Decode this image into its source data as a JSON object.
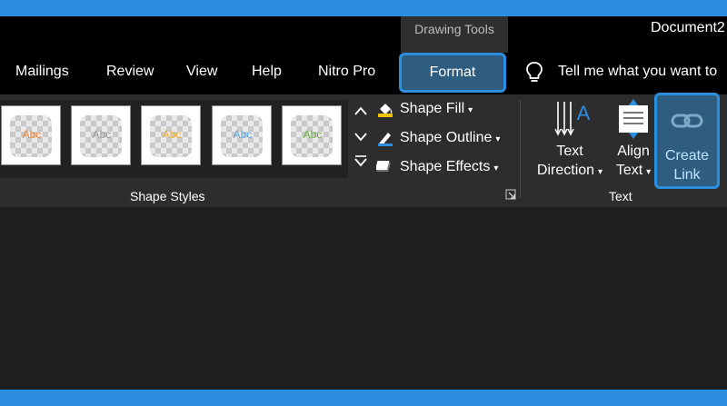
{
  "window": {
    "context_label": "Drawing Tools",
    "doc_title": "Document2"
  },
  "tabs": {
    "mailings": "Mailings",
    "review": "Review",
    "view": "View",
    "help": "Help",
    "nitro": "Nitro Pro",
    "format": "Format"
  },
  "tellme": "Tell me what you want to",
  "shape_styles": {
    "group_label": "Shape Styles",
    "thumb_text": "Abc",
    "thumb_colors": [
      "#f0863a",
      "#9b9b9b",
      "#f0b030",
      "#5ba8e0",
      "#6fb04a"
    ],
    "fill_label": "Shape Fill",
    "outline_label": "Shape Outline",
    "effects_label": "Shape Effects"
  },
  "text_group": {
    "group_label": "Text",
    "direction_line1": "Text",
    "direction_line2": "Direction",
    "align_line1": "Align",
    "align_line2": "Text",
    "create_line1": "Create",
    "create_line2": "Link"
  },
  "colors": {
    "accent": "#2b8ede",
    "ribbon_bg": "#2d2d2d",
    "selected_tab": "#2e5d80"
  }
}
